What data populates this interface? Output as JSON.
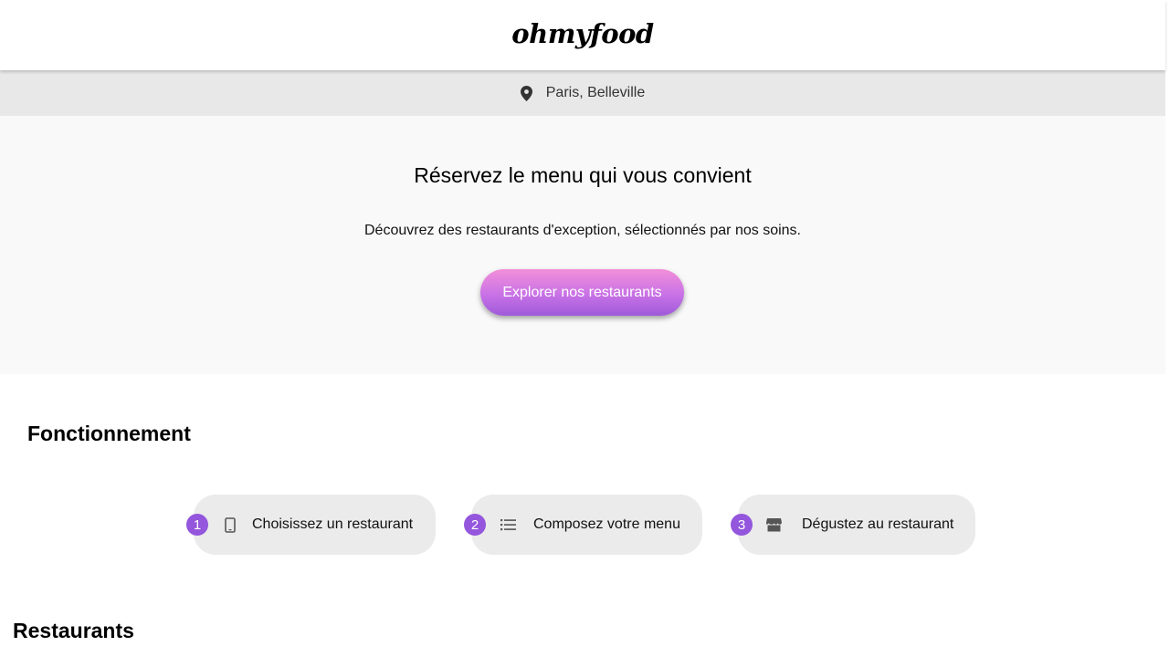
{
  "header": {
    "logo": "ohmyfood",
    "location_icon": "map-pin-icon",
    "location": "Paris, Belleville"
  },
  "hero": {
    "title": "Réservez le menu qui vous convient",
    "subtitle": "Découvrez des restaurants d'exception, sélectionnés par nos soins.",
    "cta_label": "Explorer nos restaurants"
  },
  "how_it_works": {
    "title": "Fonctionnement",
    "steps": [
      {
        "number": "1",
        "icon": "smartphone-icon",
        "label": "Choisissez un restaurant"
      },
      {
        "number": "2",
        "icon": "list-icon",
        "label": "Composez votre menu"
      },
      {
        "number": "3",
        "icon": "store-icon",
        "label": "Dégustez au restaurant"
      }
    ]
  },
  "restaurants": {
    "title": "Restaurants"
  },
  "colors": {
    "accent_purple": "#9356dc",
    "cta_gradient_top": "#f38fd9",
    "cta_gradient_bottom": "#9f5bd9",
    "location_bar_bg": "#e8e8e8",
    "hero_bg": "#f9f9f9",
    "step_bg": "#ebebeb"
  }
}
